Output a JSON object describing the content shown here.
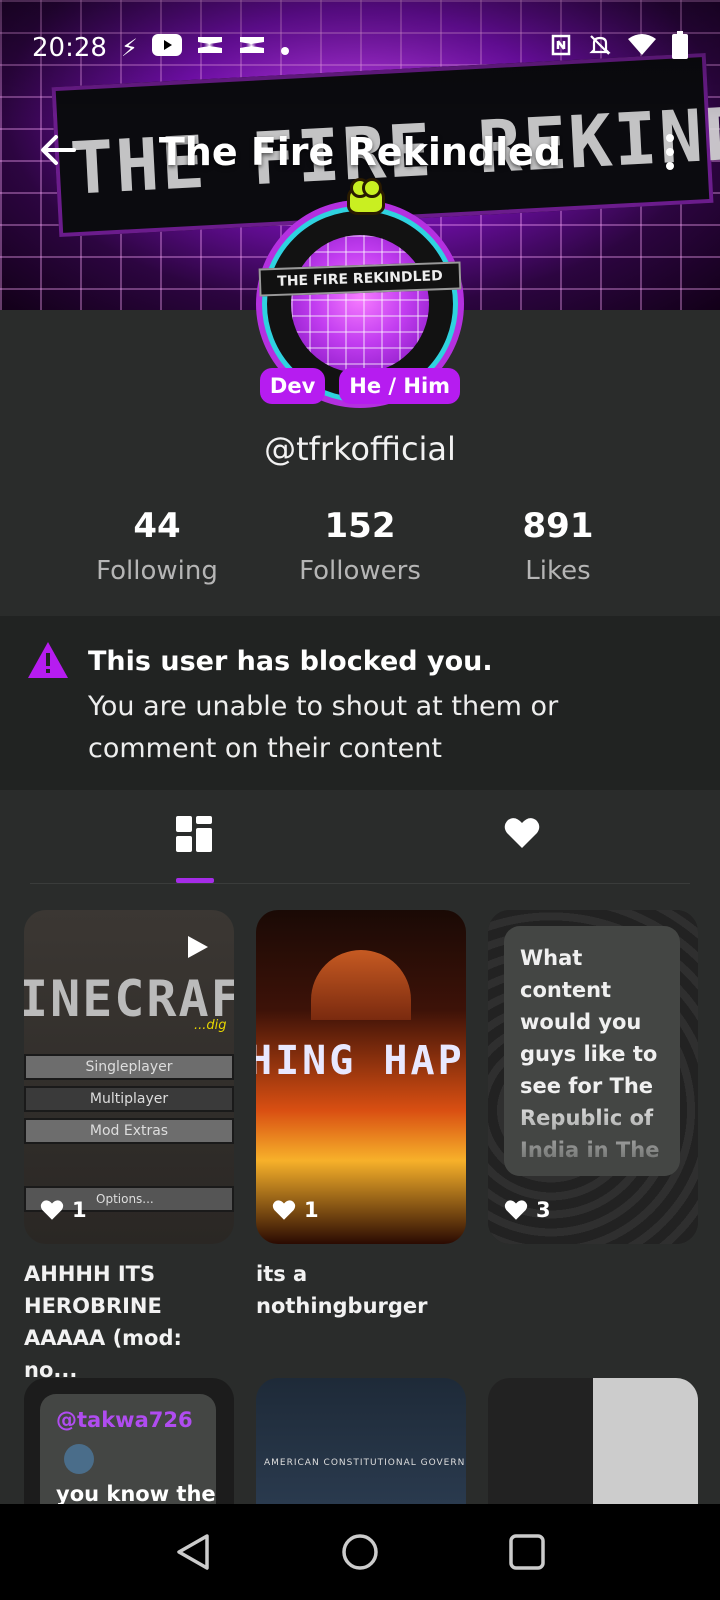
{
  "status_bar": {
    "time": "20:28",
    "left_icons": [
      "flash-icon",
      "youtube-icon",
      "capcut-icon",
      "capcut-icon",
      "dot-icon"
    ],
    "right_icons": [
      "nfc-icon",
      "mute-icon",
      "wifi-icon",
      "battery-icon"
    ]
  },
  "header": {
    "title": "The Fire Rekindled",
    "banner_text": "THE FIRE REKINDLED"
  },
  "profile": {
    "avatar_text": "THE FIRE REKINDLED",
    "badges": [
      "Dev",
      "He / Him"
    ],
    "handle": "@tfrkofficial"
  },
  "stats": [
    {
      "value": "44",
      "label": "Following"
    },
    {
      "value": "152",
      "label": "Followers"
    },
    {
      "value": "891",
      "label": "Likes"
    }
  ],
  "blocked_notice": {
    "title": "This user has blocked you.",
    "message": "You are unable to shout at them or comment on their content"
  },
  "tabs": [
    {
      "name": "posts",
      "icon": "grid-icon",
      "selected": true
    },
    {
      "name": "likes",
      "icon": "heart-icon",
      "selected": false
    }
  ],
  "posts": [
    {
      "likes": "1",
      "caption": "AHHHH ITS HEROBRINE AAAAA (mod: no...",
      "thumb_logo": "INECRAF",
      "thumb_sub": "...dig",
      "menu_items": [
        "Singleplayer",
        "Multiplayer",
        "Mod Extras",
        "Options..."
      ]
    },
    {
      "likes": "1",
      "caption": "its a nothingburger",
      "thumb_text": "HING HAPP"
    },
    {
      "likes": "3",
      "caption": "",
      "text": "What content would you guys like to see for The Republic of India in The"
    }
  ],
  "posts_row2": [
    {
      "mention": "@takwa726",
      "snippet": "you know the"
    },
    {
      "map_text": "AMERICAN CONSTITUTIONAL GOVERNMENT"
    },
    {}
  ],
  "colors": {
    "accent": "#b61cf0",
    "background": "#2a2c2b",
    "notice_bg": "#212322"
  }
}
